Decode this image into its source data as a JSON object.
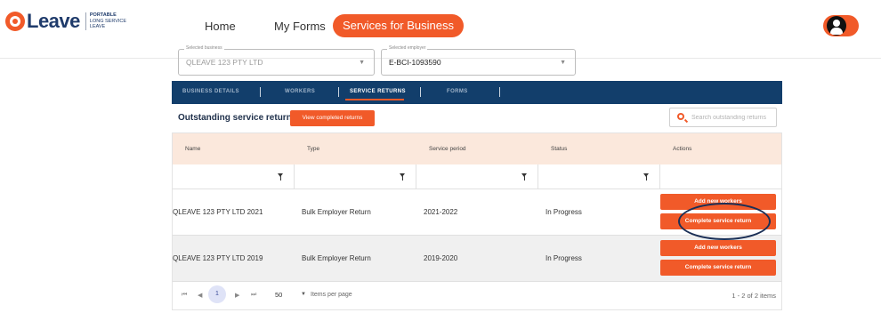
{
  "brand": {
    "name": "Leave",
    "tagline": [
      "PORTABLE",
      "LONG SERVICE",
      "LEAVE"
    ]
  },
  "nav": {
    "home": "Home",
    "my_forms": "My Forms",
    "services": "Services for Business"
  },
  "selectors": {
    "business_label": "Selected business",
    "business_value": "QLEAVE 123 PTY LTD",
    "employer_label": "Selected employer",
    "employer_value": "E-BCI-1093590"
  },
  "tabs": [
    "BUSINESS DETAILS",
    "WORKERS",
    "SERVICE RETURNS",
    "FORMS"
  ],
  "active_tab": "SERVICE RETURNS",
  "toolbar": {
    "title": "Outstanding service returns",
    "completed_button": "View completed returns",
    "search_placeholder": "Search outstanding returns"
  },
  "table": {
    "columns": [
      "Name",
      "Type",
      "Service period",
      "Status",
      "Actions"
    ],
    "rows": [
      {
        "name": "QLEAVE 123 PTY LTD 2021",
        "type": "Bulk Employer Return",
        "period": "2021-2022",
        "status": "In Progress",
        "add_workers": "Add new workers",
        "complete": "Complete service return"
      },
      {
        "name": "QLEAVE 123 PTY LTD 2019",
        "type": "Bulk Employer Return",
        "period": "2019-2020",
        "status": "In Progress",
        "add_workers": "Add new workers",
        "complete": "Complete service return"
      }
    ]
  },
  "pager": {
    "current_page": "1",
    "page_size": "50",
    "items_per_page_label": "Items per page",
    "info": "1 - 2 of 2 items"
  },
  "colors": {
    "accent": "#f15a29",
    "navy": "#123e6b",
    "header_row": "#fbe8dc"
  }
}
